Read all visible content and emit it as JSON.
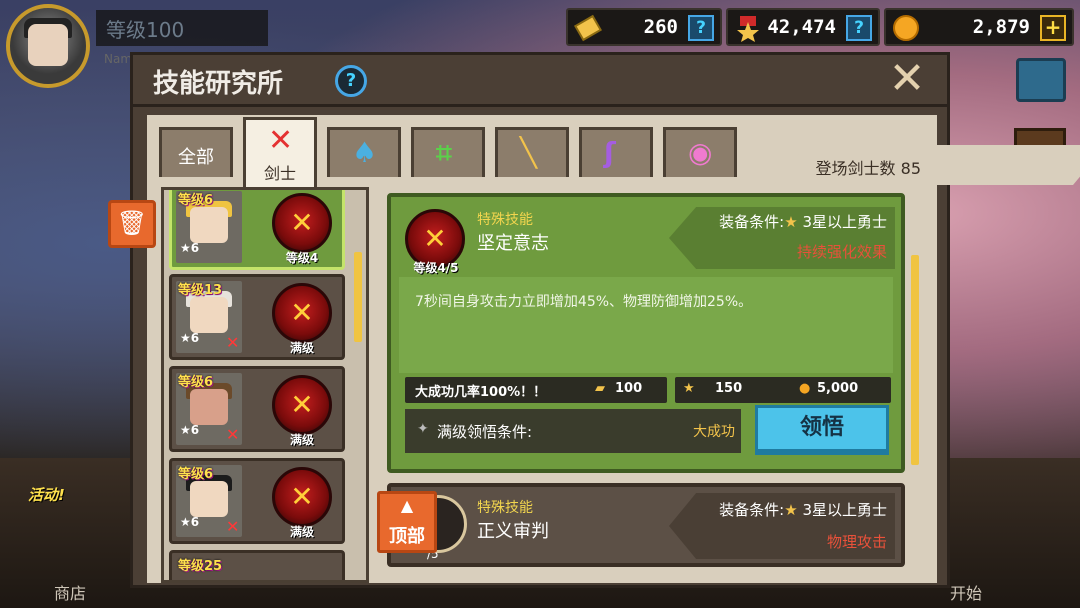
{
  "hud": {
    "player_level": "等级100",
    "name_label": "Nam",
    "currencies": [
      {
        "name": "ticket",
        "value": "260",
        "button": "?"
      },
      {
        "name": "medal",
        "value": "42,474",
        "button": "?"
      },
      {
        "name": "gold",
        "value": "2,879",
        "button": "+"
      }
    ]
  },
  "panel": {
    "title": "技能研究所",
    "help": "?",
    "close": "✕",
    "tabs": [
      {
        "label": "全部",
        "icon": "all-icon"
      },
      {
        "label": "剑士",
        "icon": "sword-icon",
        "active": true
      },
      {
        "label": "",
        "icon": "axe-icon"
      },
      {
        "label": "",
        "icon": "bow-icon"
      },
      {
        "label": "",
        "icon": "staff-icon"
      },
      {
        "label": "",
        "icon": "wand-icon"
      },
      {
        "label": "",
        "icon": "pendant-icon"
      }
    ],
    "knight_count": "登场剑士数 85"
  },
  "hero_list": [
    {
      "level": "等级6",
      "stars": "6",
      "skill_level": "等级4",
      "selected": true
    },
    {
      "level": "等级13",
      "stars": "6",
      "skill_level": "满级"
    },
    {
      "level": "等级6",
      "stars": "6",
      "skill_level": "满级"
    },
    {
      "level": "等级6",
      "stars": "6",
      "skill_level": "满级"
    },
    {
      "level": "等级25",
      "stars": "",
      "skill_level": ""
    }
  ],
  "skill_detail": {
    "type": "特殊技能",
    "name": "坚定意志",
    "orb_level": "等级4/5",
    "equip_condition": "装备条件:",
    "equip_requirement": "3星以上勇士",
    "effect_tag": "持续强化效果",
    "description": "7秒间自身攻击力立即增加45%、物理防御增加25%。",
    "success_rate": "大成功几率100%！！",
    "costs": [
      {
        "icon": "ticket-icon",
        "value": "100"
      },
      {
        "icon": "medal-icon",
        "value": "150"
      },
      {
        "icon": "gold-icon",
        "value": "5,000"
      }
    ],
    "max_condition_label": "满级领悟条件:",
    "max_condition_value": "大成功",
    "learn_button": "领悟"
  },
  "skill_detail_2": {
    "type": "特殊技能",
    "name": "正义审判",
    "orb_level": "/5",
    "equip_condition": "装备条件:",
    "equip_requirement": "3星以上勇士",
    "effect_tag": "物理攻击"
  },
  "top_button": "顶部",
  "activity_label": "活动!",
  "bottom_nav": [
    "商店",
    "开始"
  ],
  "colors": {
    "selected_green": "#6f9b3e",
    "learn_blue": "#4cc3ea",
    "accent_orange": "#e8692d",
    "effect_red": "#e8513a",
    "skill_type_yellow": "#f2d54e"
  }
}
